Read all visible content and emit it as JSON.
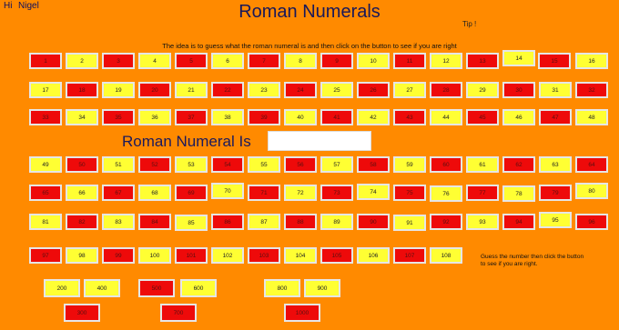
{
  "header": {
    "greeting": "Hi",
    "user_name": "Nigel",
    "title": "Roman Numerals",
    "tip_link": "Tip !",
    "intro": "The idea is to guess what the roman numeral is and then click on the button to see if you are right"
  },
  "answer": {
    "label": "Roman Numeral Is",
    "value": ""
  },
  "hint": {
    "line1": "Guess the number then click the button",
    "line2": "to see if you are right."
  },
  "colors": {
    "background": "#ff8a00",
    "button_yellow": "#ffff33",
    "button_red": "#ee0a0a"
  },
  "number_rows": [
    [
      "1",
      "2",
      "3",
      "4",
      "5",
      "6",
      "7",
      "8",
      "9",
      "10",
      "11",
      "12",
      "13",
      "14",
      "15",
      "16"
    ],
    [
      "17",
      "18",
      "19",
      "20",
      "21",
      "22",
      "23",
      "24",
      "25",
      "26",
      "27",
      "28",
      "29",
      "30",
      "31",
      "32"
    ],
    [
      "33",
      "34",
      "35",
      "36",
      "37",
      "38",
      "39",
      "40",
      "41",
      "42",
      "43",
      "44",
      "45",
      "46",
      "47",
      "48"
    ],
    [
      "49",
      "50",
      "51",
      "52",
      "53",
      "54",
      "55",
      "56",
      "57",
      "58",
      "59",
      "60",
      "61",
      "62",
      "63",
      "64"
    ],
    [
      "65",
      "66",
      "67",
      "68",
      "69",
      "70",
      "71",
      "72",
      "73",
      "74",
      "75",
      "76",
      "77",
      "78",
      "79",
      "80"
    ],
    [
      "81",
      "82",
      "83",
      "84",
      "85",
      "86",
      "87",
      "88",
      "89",
      "90",
      "91",
      "92",
      "93",
      "94",
      "95",
      "96"
    ],
    [
      "97",
      "98",
      "99",
      "100",
      "101",
      "102",
      "103",
      "104",
      "105",
      "106",
      "107",
      "108"
    ]
  ],
  "number_row_colors": [
    [
      "r",
      "y",
      "r",
      "y",
      "r",
      "y",
      "r",
      "y",
      "r",
      "y",
      "r",
      "y",
      "r",
      "y",
      "r",
      "y"
    ],
    [
      "y",
      "r",
      "y",
      "r",
      "y",
      "r",
      "y",
      "r",
      "y",
      "r",
      "y",
      "r",
      "y",
      "r",
      "y",
      "r"
    ],
    [
      "r",
      "y",
      "r",
      "y",
      "r",
      "y",
      "r",
      "y",
      "r",
      "y",
      "r",
      "y",
      "r",
      "y",
      "r",
      "y"
    ],
    [
      "y",
      "r",
      "y",
      "r",
      "y",
      "r",
      "y",
      "r",
      "y",
      "r",
      "y",
      "r",
      "y",
      "r",
      "y",
      "r"
    ],
    [
      "r",
      "y",
      "r",
      "y",
      "r",
      "y",
      "r",
      "y",
      "r",
      "y",
      "r",
      "y",
      "r",
      "y",
      "r",
      "y"
    ],
    [
      "y",
      "r",
      "y",
      "r",
      "y",
      "r",
      "y",
      "r",
      "y",
      "r",
      "y",
      "r",
      "y",
      "r",
      "y",
      "r"
    ],
    [
      "r",
      "y",
      "r",
      "y",
      "r",
      "y",
      "r",
      "y",
      "r",
      "y",
      "r",
      "y"
    ]
  ],
  "hundreds_row1": [
    {
      "label": "200",
      "color": "y"
    },
    {
      "label": "400",
      "color": "y"
    },
    {
      "label": "500",
      "color": "r"
    },
    {
      "label": "600",
      "color": "y"
    },
    {
      "label": "800",
      "color": "y"
    },
    {
      "label": "900",
      "color": "y"
    }
  ],
  "hundreds_row2": [
    {
      "label": "300",
      "color": "r"
    },
    {
      "label": "700",
      "color": "r"
    },
    {
      "label": "1000",
      "color": "r"
    }
  ]
}
